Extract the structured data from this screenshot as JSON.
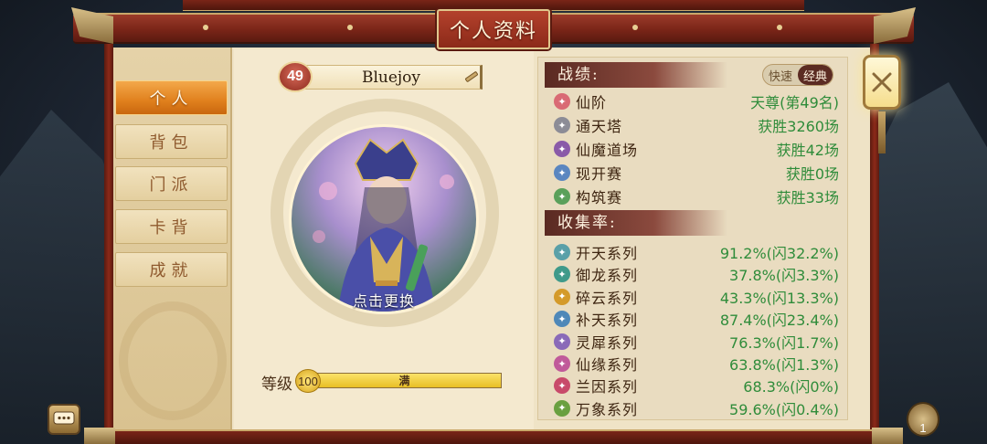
{
  "window": {
    "title": "个人资料"
  },
  "tabs": [
    {
      "label": "个人",
      "active": true
    },
    {
      "label": "背包",
      "active": false
    },
    {
      "label": "门派",
      "active": false
    },
    {
      "label": "卡背",
      "active": false
    },
    {
      "label": "成就",
      "active": false
    }
  ],
  "profile": {
    "level": "49",
    "name": "Bluejoy",
    "avatar_action": "点击更换",
    "grade_label": "等级",
    "grade_value": "100",
    "grade_status": "满",
    "grade_progress": 1.0
  },
  "record": {
    "title": "战绩:",
    "mode_options": [
      "快速",
      "经典"
    ],
    "mode_selected": "经典",
    "rows": [
      {
        "icon": "star-icon",
        "color": "#d96a74",
        "label": "仙阶",
        "value": "天尊(第49名)"
      },
      {
        "icon": "tower-icon",
        "color": "#8c8c96",
        "label": "通天塔",
        "value": "获胜3260场"
      },
      {
        "icon": "demon-path-icon",
        "color": "#8a5aa8",
        "label": "仙魔道场",
        "value": "获胜42场"
      },
      {
        "icon": "open-match-icon",
        "color": "#5a86c0",
        "label": "现开赛",
        "value": "获胜0场"
      },
      {
        "icon": "build-match-icon",
        "color": "#5aa05a",
        "label": "构筑赛",
        "value": "获胜33场"
      }
    ]
  },
  "collection": {
    "title": "收集率:",
    "rows": [
      {
        "icon": "kaitian-icon",
        "color": "#5aa0a8",
        "label": "开天系列",
        "value": "91.2%(闪32.2%)"
      },
      {
        "icon": "yulong-icon",
        "color": "#3f9a8a",
        "label": "御龙系列",
        "value": "37.8%(闪3.3%)"
      },
      {
        "icon": "suiyun-icon",
        "color": "#d49a2a",
        "label": "碎云系列",
        "value": "43.3%(闪13.3%)"
      },
      {
        "icon": "butian-icon",
        "color": "#4f88b8",
        "label": "补天系列",
        "value": "87.4%(闪23.4%)"
      },
      {
        "icon": "lingxi-icon",
        "color": "#8a6ab8",
        "label": "灵犀系列",
        "value": "76.3%(闪1.7%)"
      },
      {
        "icon": "xianyuan-icon",
        "color": "#c05a9a",
        "label": "仙缘系列",
        "value": "63.8%(闪1.3%)"
      },
      {
        "icon": "lanyin-icon",
        "color": "#c84a6a",
        "label": "兰因系列",
        "value": "68.3%(闪0%)"
      },
      {
        "icon": "wanxiang-icon",
        "color": "#6aa040",
        "label": "万象系列",
        "value": "59.6%(闪0.4%)"
      }
    ]
  },
  "friends": {
    "count": "1"
  }
}
